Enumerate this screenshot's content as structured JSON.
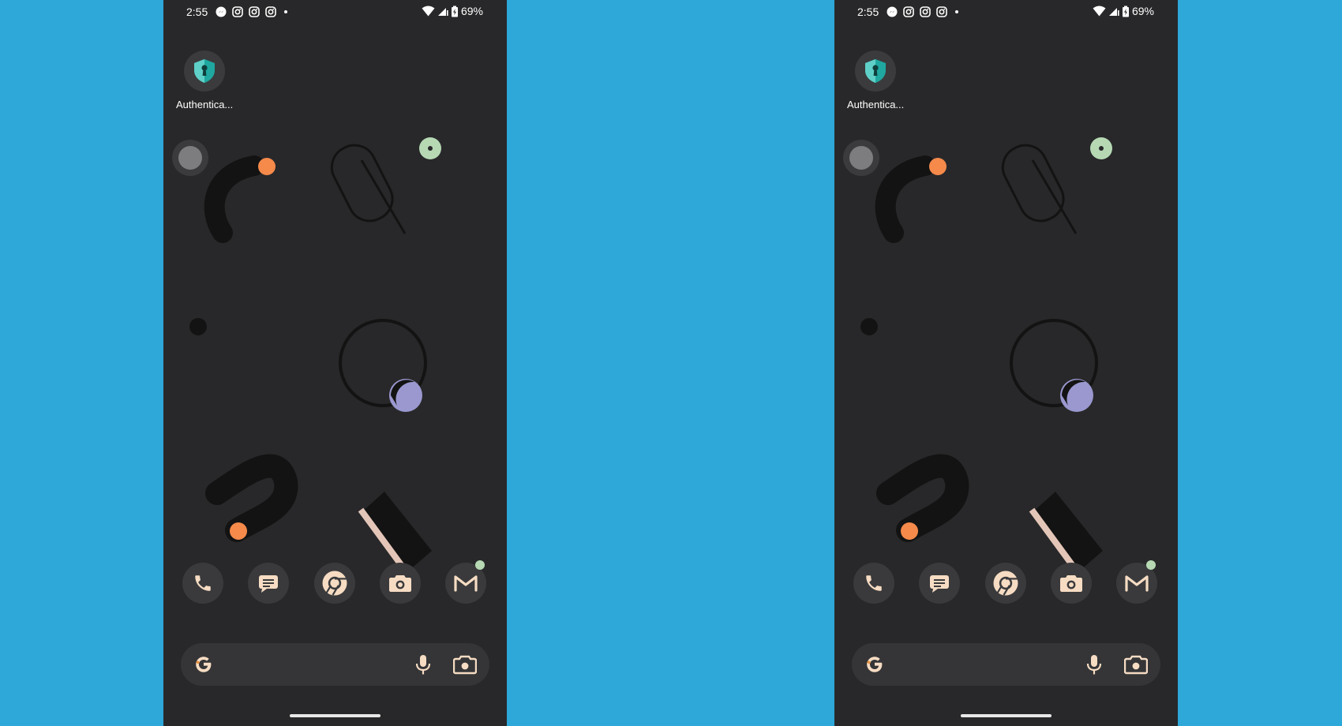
{
  "screens": [
    {
      "status_bar": {
        "time": "2:55",
        "battery_percent": "69%",
        "notification_icons": [
          "messenger-icon",
          "instagram-icon",
          "instagram-icon",
          "instagram-icon",
          "dot-icon"
        ]
      },
      "home_app": {
        "label": "Authentica...",
        "icon": "authenticator-shield-icon"
      },
      "dock": [
        {
          "name": "phone",
          "icon": "phone-icon"
        },
        {
          "name": "messages",
          "icon": "messages-icon"
        },
        {
          "name": "chrome",
          "icon": "chrome-icon"
        },
        {
          "name": "camera",
          "icon": "camera-icon"
        },
        {
          "name": "gmail",
          "icon": "gmail-icon",
          "badge": true
        }
      ],
      "search_bar": {
        "logo": "google-g-icon",
        "mic": "mic-icon",
        "lens": "lens-icon"
      }
    },
    {
      "status_bar": {
        "time": "2:55",
        "battery_percent": "69%",
        "notification_icons": [
          "messenger-icon",
          "instagram-icon",
          "instagram-icon",
          "instagram-icon",
          "dot-icon"
        ]
      },
      "home_app": {
        "label": "Authentica...",
        "icon": "authenticator-shield-icon"
      },
      "dock": [
        {
          "name": "phone",
          "icon": "phone-icon"
        },
        {
          "name": "messages",
          "icon": "messages-icon"
        },
        {
          "name": "chrome",
          "icon": "chrome-icon"
        },
        {
          "name": "camera",
          "icon": "camera-icon"
        },
        {
          "name": "gmail",
          "icon": "gmail-icon",
          "badge": true
        }
      ],
      "search_bar": {
        "logo": "google-g-icon",
        "mic": "mic-icon",
        "lens": "lens-icon"
      }
    }
  ],
  "colors": {
    "background": "#2ea7d9",
    "phone_background": "#28282a",
    "icon_tint": "#f6dcc3",
    "accent_orange": "#f58a4b",
    "accent_mint": "#b6d9b4",
    "accent_lavender": "#9a98cf",
    "accent_teal": "#1fa7a0"
  }
}
